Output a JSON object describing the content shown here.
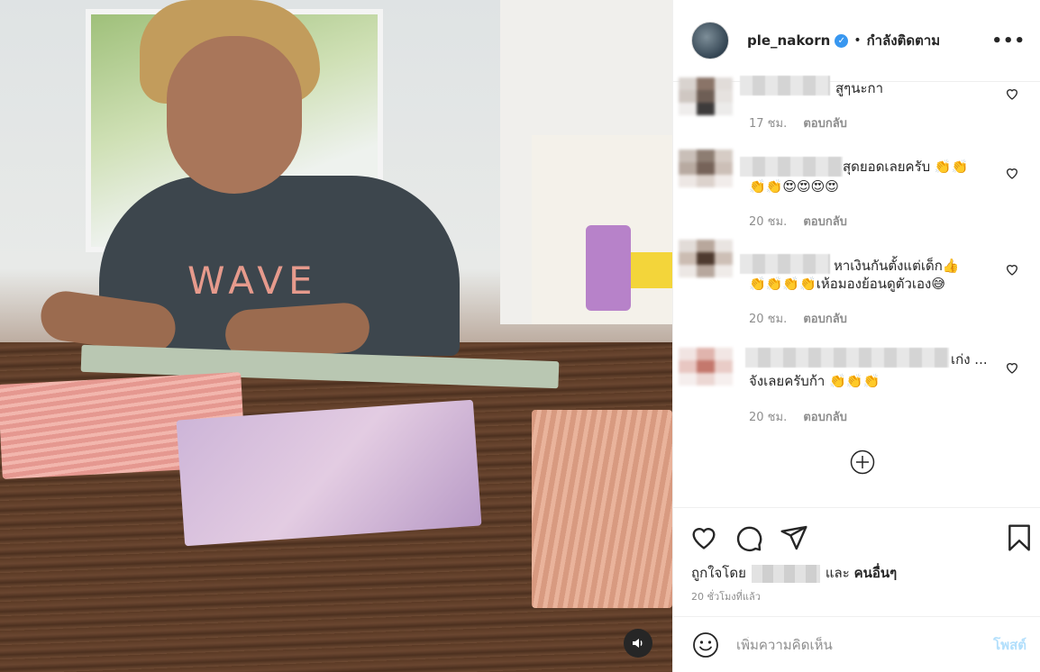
{
  "media": {
    "shirt_text": "WAVE",
    "sound_icon": "speaker-icon"
  },
  "header": {
    "username": "ple_nakorn",
    "verified_icon": "verified-badge-icon",
    "separator": "•",
    "follow_status": "กำลังติดตาม",
    "more_icon": "more-options-icon"
  },
  "comments": [
    {
      "text": "สูๆนะกา",
      "time": "17 ชม.",
      "reply": "ตอบกลับ"
    },
    {
      "text": "สุดยอดเลยครับ 👏👏",
      "text2": "👏👏😍😍😍😍",
      "time": "20 ชม.",
      "reply": "ตอบกลับ"
    },
    {
      "text": "หาเงินกันตั้งแต่เด็ก👍",
      "text2": "👏👏👏👏เห้อมองย้อนดูตัวเอง😅",
      "time": "20 ชม.",
      "reply": "ตอบกลับ"
    },
    {
      "text": "เก่ง ...",
      "text2": "จังเลยครับก้า 👏👏👏",
      "time": "20 ชม.",
      "reply": "ตอบกลับ"
    }
  ],
  "load_more_icon": "plus-circle-icon",
  "actions": {
    "like_icon": "heart-icon",
    "comment_icon": "comment-icon",
    "share_icon": "share-icon",
    "save_icon": "bookmark-icon"
  },
  "likes": {
    "prefix": "ถูกใจโดย",
    "and": "และ",
    "others": "คนอื่นๆ"
  },
  "timestamp": "20 ชั่วโมงที่แล้ว",
  "composer": {
    "emoji_icon": "emoji-icon",
    "placeholder": "เพิ่มความคิดเห็น",
    "post_label": "โพสต์"
  },
  "colors": {
    "verified": "#3897f0",
    "post_disabled": "#b2dffc",
    "meta_text": "#8e8e8e"
  }
}
